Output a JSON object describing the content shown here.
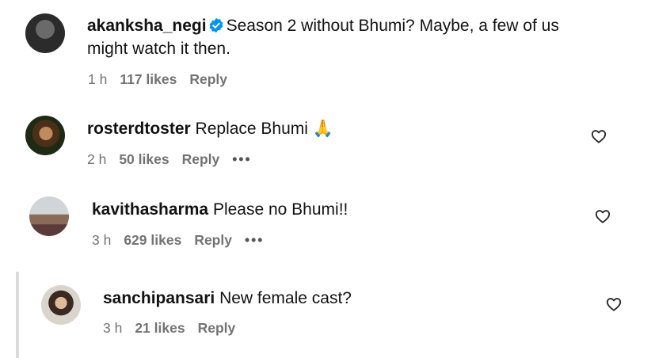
{
  "comments": [
    {
      "username": "akanksha_negi",
      "verified": true,
      "text": "Season 2 without Bhumi? Maybe, a few of us",
      "text_line2": "might watch it then.",
      "time": "1 h",
      "likes": "117 likes",
      "reply": "Reply"
    },
    {
      "username": "rosterdtoster",
      "text": "Replace Bhumi 🙏",
      "time": "2 h",
      "likes": "50 likes",
      "reply": "Reply",
      "more": "•••"
    },
    {
      "username": "kavithasharma",
      "text": "Please no Bhumi!!",
      "time": "3 h",
      "likes": "629 likes",
      "reply": "Reply",
      "more": "•••"
    },
    {
      "username": "sanchipansari",
      "text": "New female cast?",
      "time": "3 h",
      "likes": "21 likes",
      "reply": "Reply"
    }
  ],
  "icons": {
    "verified": "verified-badge-icon",
    "like": "heart-outline-icon",
    "more": "more-options-icon"
  },
  "colors": {
    "verified_blue": "#0095f6",
    "meta_gray": "#737373",
    "thread_line": "#dbdbdb"
  }
}
